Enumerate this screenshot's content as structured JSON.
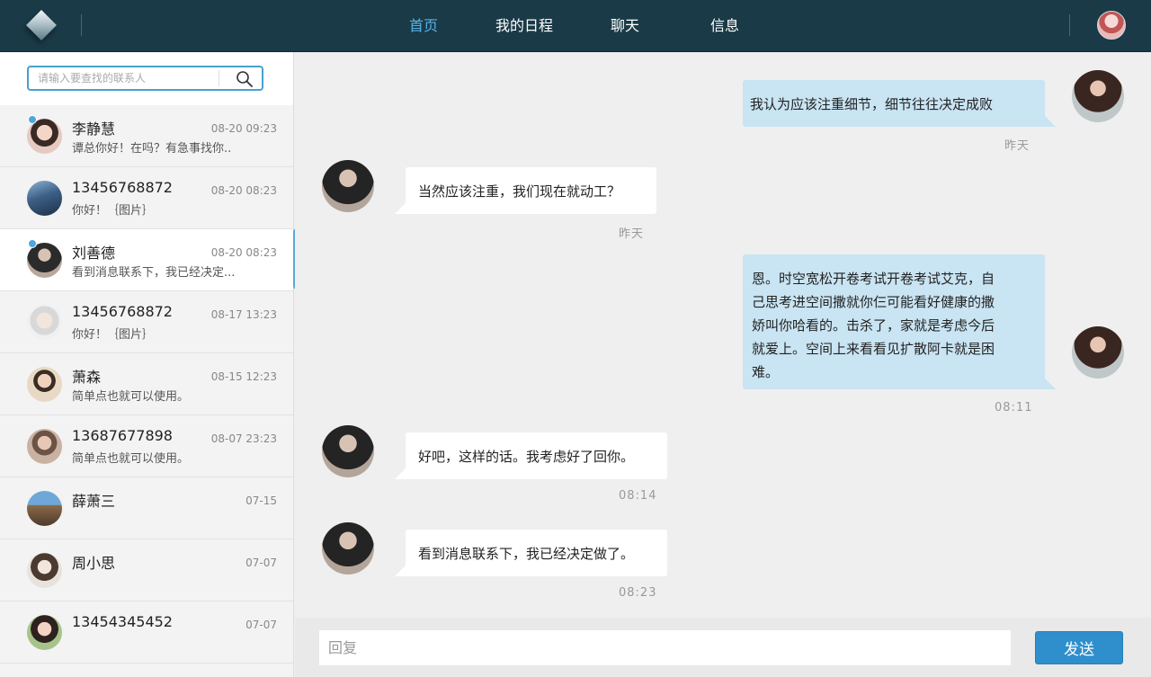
{
  "nav": {
    "items": [
      {
        "label": "首页",
        "active": true
      },
      {
        "label": "我的日程",
        "active": false
      },
      {
        "label": "聊天",
        "active": false
      },
      {
        "label": "信息",
        "active": false
      }
    ]
  },
  "search": {
    "placeholder": "请输入要查找的联系人"
  },
  "contacts": [
    {
      "name": "李静慧",
      "time": "08-20  09:23",
      "preview": "谭总你好！在吗？有急事找你..",
      "unread": true
    },
    {
      "name": "13456768872",
      "time": "08-20  08:23",
      "preview": "你好！｛图片｝",
      "unread": false
    },
    {
      "name": "刘善德",
      "time": "08-20  08:23",
      "preview": "看到消息联系下，我已经决定...",
      "unread": true,
      "selected": true
    },
    {
      "name": "13456768872",
      "time": "08-17  13:23",
      "preview": "你好！｛图片｝",
      "unread": false
    },
    {
      "name": "萧森",
      "time": "08-15  12:23",
      "preview": "简单点也就可以使用。",
      "unread": false
    },
    {
      "name": "13687677898",
      "time": "08-07  23:23",
      "preview": "简单点也就可以使用。",
      "unread": false
    },
    {
      "name": "薛萧三",
      "time": "07-15",
      "preview": "",
      "unread": false
    },
    {
      "name": "周小思",
      "time": "07-07",
      "preview": "",
      "unread": false
    },
    {
      "name": "13454345452",
      "time": "07-07",
      "preview": "",
      "unread": false
    }
  ],
  "messages": [
    {
      "direction": "out",
      "text": "我认为应该注重细节，细节往往决定成败",
      "stamp": "昨天"
    },
    {
      "direction": "in",
      "text": "当然应该注重，我们现在就动工？",
      "stamp": "昨天"
    },
    {
      "direction": "out",
      "lines": [
        "恩。时空宽松开卷考试开卷考试艾克，自",
        "己思考进空间撒就你仨可能看好健康的撒",
        "娇叫你哈看的。击杀了，家就是考虑今后",
        "就爱上。空间上来看看见扩散阿卡就是困",
        "难。"
      ],
      "stamp": "08:11"
    },
    {
      "direction": "in",
      "text": "好吧，这样的话。我考虑好了回你。",
      "stamp": "08:14"
    },
    {
      "direction": "in",
      "text": "看到消息联系下，我已经决定做了。",
      "stamp": "08:23"
    }
  ],
  "reply": {
    "placeholder": "回复",
    "send_label": "发送"
  },
  "colors": {
    "topbar": "#1a3a47",
    "accent": "#59b3e6",
    "bubble_out": "#c9e4f3",
    "send": "#2f8fcc"
  }
}
